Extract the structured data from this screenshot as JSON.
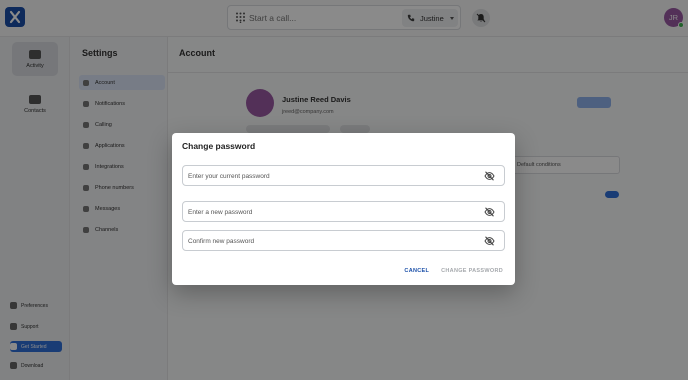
{
  "topbar": {
    "call_placeholder": "Start a call...",
    "caller_name": "Justine",
    "avatar_initials": "JR"
  },
  "rail": {
    "items": [
      "Activity",
      "Contacts"
    ],
    "bottom": [
      "Preferences",
      "Support",
      "Get Started",
      "Download"
    ]
  },
  "settings": {
    "title": "Settings",
    "items": [
      "Account",
      "Notifications",
      "Calling",
      "Applications",
      "Integrations",
      "Phone numbers",
      "Messages",
      "Channels"
    ]
  },
  "main": {
    "title": "Account",
    "profile_name": "Justine Reed Davis",
    "profile_email": "jreed@company.com",
    "select_label": "Default conditions"
  },
  "dialog": {
    "title": "Change password",
    "current_placeholder": "Enter your current password",
    "new_placeholder": "Enter a new password",
    "confirm_placeholder": "Confirm new password",
    "cancel_label": "CANCEL",
    "change_label": "CHANGE PASSWORD"
  },
  "colors": {
    "brand": "#1a4fa8",
    "accent": "#2f6fd8",
    "avatar": "#9a5aa3",
    "presence": "#3fb451"
  }
}
